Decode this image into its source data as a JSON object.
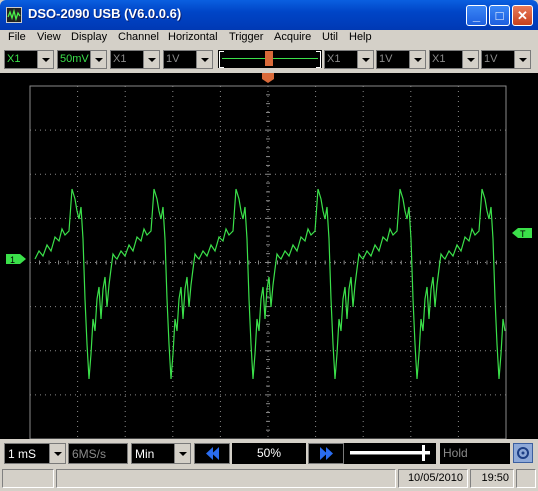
{
  "window": {
    "title": "DSO-2090 USB (V6.0.0.6)"
  },
  "titlebar_buttons": {
    "minimize": "_",
    "maximize": "□",
    "close": "✕"
  },
  "menu": [
    "File",
    "View",
    "Display",
    "Channel",
    "Horizontal",
    "Trigger",
    "Acquire",
    "Util",
    "Help"
  ],
  "control_bar": {
    "ch1_probe": "X1",
    "ch1_volts": "50mV",
    "ch2_probe": "X1",
    "ch2_volts": "1V",
    "ext_probe_1": "X1",
    "ext_volts_1": "1V",
    "ext_probe_2": "X1",
    "ext_volts_2": "1V"
  },
  "scope": {
    "background": "#000000",
    "grid_color": "#8a8a8a",
    "trace_color": "#3be04a",
    "trigger_marker_color": "#d96a3a",
    "ch1_marker_label": "1",
    "trigger_level_label": "T"
  },
  "status_bar": {
    "timebase": "1 mS",
    "sample_rate": "6MS/s",
    "acquisition_mode": "Min",
    "horizontal_position": "50%",
    "hold_label": "Hold"
  },
  "bottom_bar": {
    "date": "10/05/2010",
    "time": "19:50"
  },
  "icons": {
    "app": "oscilloscope-icon",
    "left": "double-left-arrow-icon",
    "right": "double-right-arrow-icon",
    "config": "settings-icon"
  },
  "colors": {
    "titlebar": "#0045c7",
    "accent_green": "#3be04a",
    "nav_arrow_blue": "#2a6cf0"
  }
}
